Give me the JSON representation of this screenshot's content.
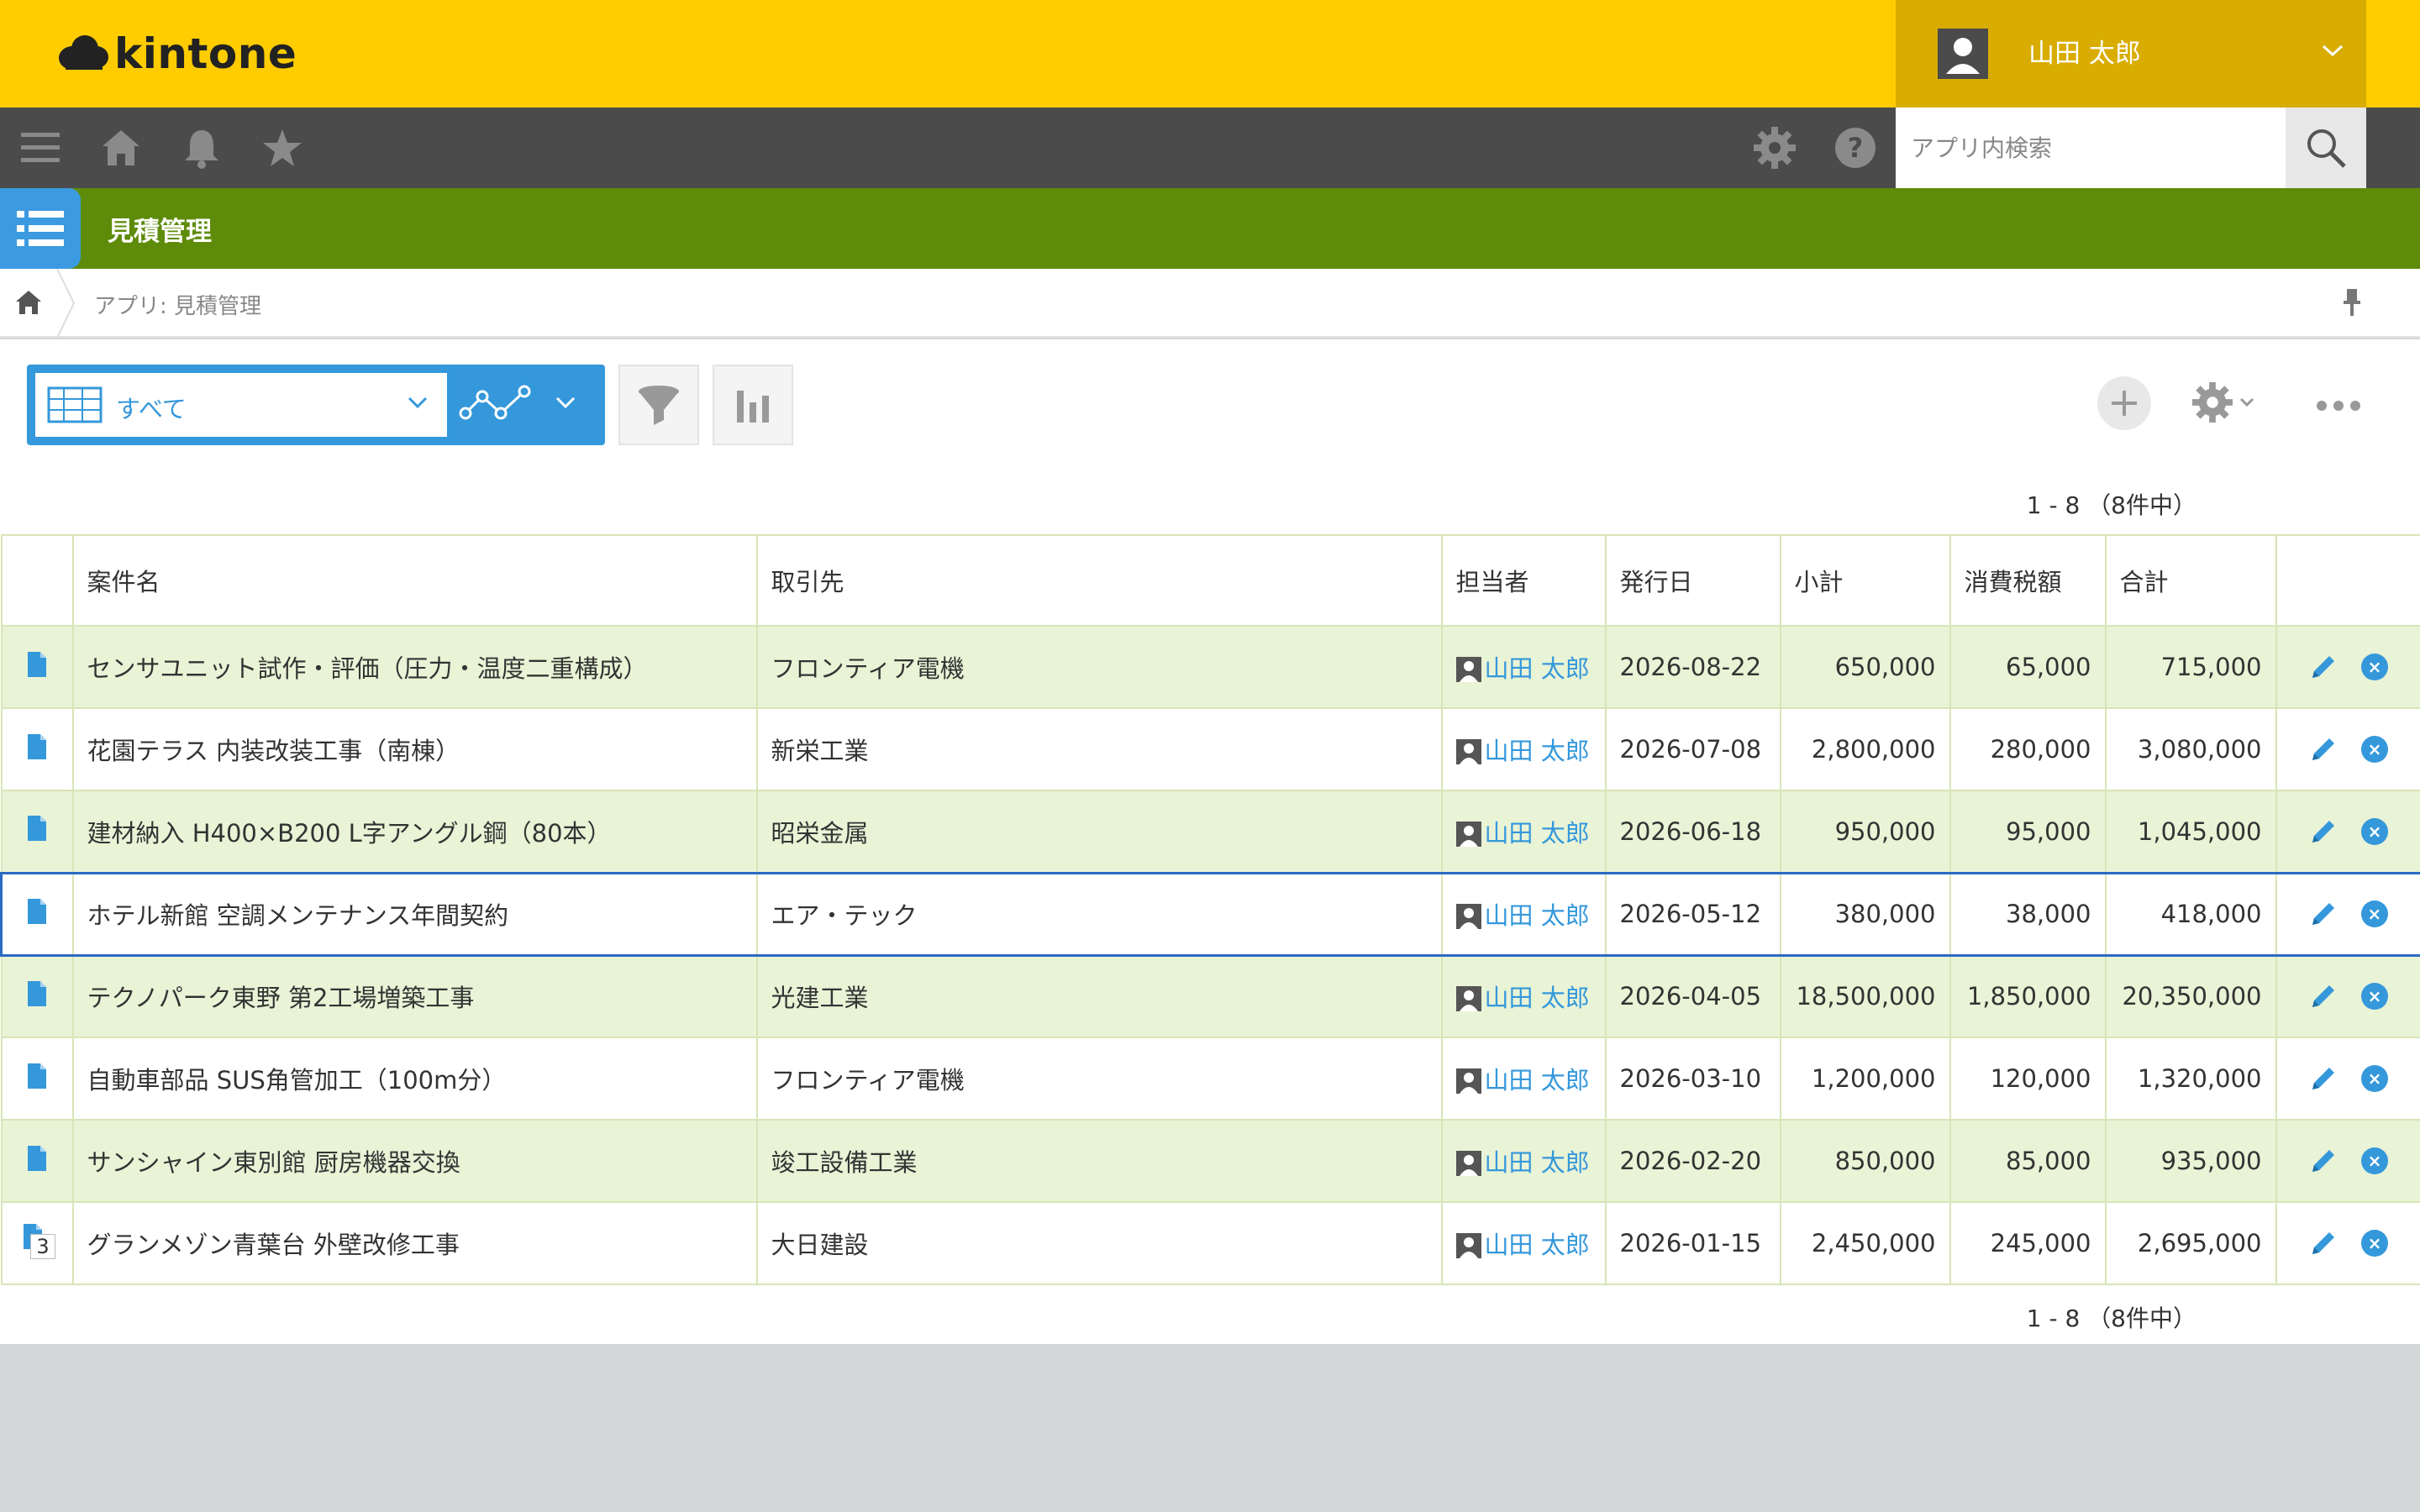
{
  "header": {
    "logo_text": "kintone",
    "user_name": "山田 太郎"
  },
  "nav": {
    "search_placeholder": "アプリ内検索"
  },
  "app": {
    "title": "見積管理",
    "breadcrumb": "アプリ: 見積管理"
  },
  "toolbar": {
    "view_label": "すべて"
  },
  "pager": {
    "text": "1 - 8 （8件中）"
  },
  "table": {
    "columns": [
      "案件名",
      "取引先",
      "担当者",
      "発行日",
      "小計",
      "消費税額",
      "合計"
    ],
    "rows": [
      {
        "name": "センサユニット試作・評価（圧力・温度二重構成）",
        "client": "フロンティア電機",
        "owner": "山田 太郎",
        "date": "2026-08-22",
        "subtotal": "650,000",
        "tax": "65,000",
        "total": "715,000"
      },
      {
        "name": "花園テラス 内装改装工事（南棟）",
        "client": "新栄工業",
        "owner": "山田 太郎",
        "date": "2026-07-08",
        "subtotal": "2,800,000",
        "tax": "280,000",
        "total": "3,080,000"
      },
      {
        "name": "建材納入 H400×B200 L字アングル鋼（80本）",
        "client": "昭栄金属",
        "owner": "山田 太郎",
        "date": "2026-06-18",
        "subtotal": "950,000",
        "tax": "95,000",
        "total": "1,045,000"
      },
      {
        "name": "ホテル新館 空調メンテナンス年間契約",
        "client": "エア・テック",
        "owner": "山田 太郎",
        "date": "2026-05-12",
        "subtotal": "380,000",
        "tax": "38,000",
        "total": "418,000"
      },
      {
        "name": "テクノパーク東野 第2工場増築工事",
        "client": "光建工業",
        "owner": "山田 太郎",
        "date": "2026-04-05",
        "subtotal": "18,500,000",
        "tax": "1,850,000",
        "total": "20,350,000"
      },
      {
        "name": "自動車部品 SUS角管加工（100m分）",
        "client": "フロンティア電機",
        "owner": "山田 太郎",
        "date": "2026-03-10",
        "subtotal": "1,200,000",
        "tax": "120,000",
        "total": "1,320,000"
      },
      {
        "name": "サンシャイン東別館 厨房機器交換",
        "client": "竣工設備工業",
        "owner": "山田 太郎",
        "date": "2026-02-20",
        "subtotal": "850,000",
        "tax": "85,000",
        "total": "935,000"
      },
      {
        "name": "グランメゾン青葉台 外壁改修工事",
        "client": "大日建設",
        "owner": "山田 太郎",
        "date": "2026-01-15",
        "subtotal": "2,450,000",
        "tax": "245,000",
        "total": "2,695,000",
        "badge": "3"
      }
    ],
    "selected_row_index": 3
  },
  "colors": {
    "header_yellow": "#ffcc00",
    "nav_dark": "#4b4b4b",
    "app_green": "#5e8c0a",
    "accent_blue": "#3498db",
    "row_alt": "#e9f3d6"
  },
  "icons": [
    "menu-icon",
    "home-icon",
    "bell-icon",
    "star-icon",
    "gear-icon",
    "help-icon",
    "search-icon",
    "list-icon",
    "pin-icon",
    "grid-icon",
    "graph-icon",
    "filter-icon",
    "bar-chart-icon",
    "plus-icon",
    "more-icon",
    "document-icon",
    "pencil-icon",
    "close-icon",
    "user-icon"
  ]
}
